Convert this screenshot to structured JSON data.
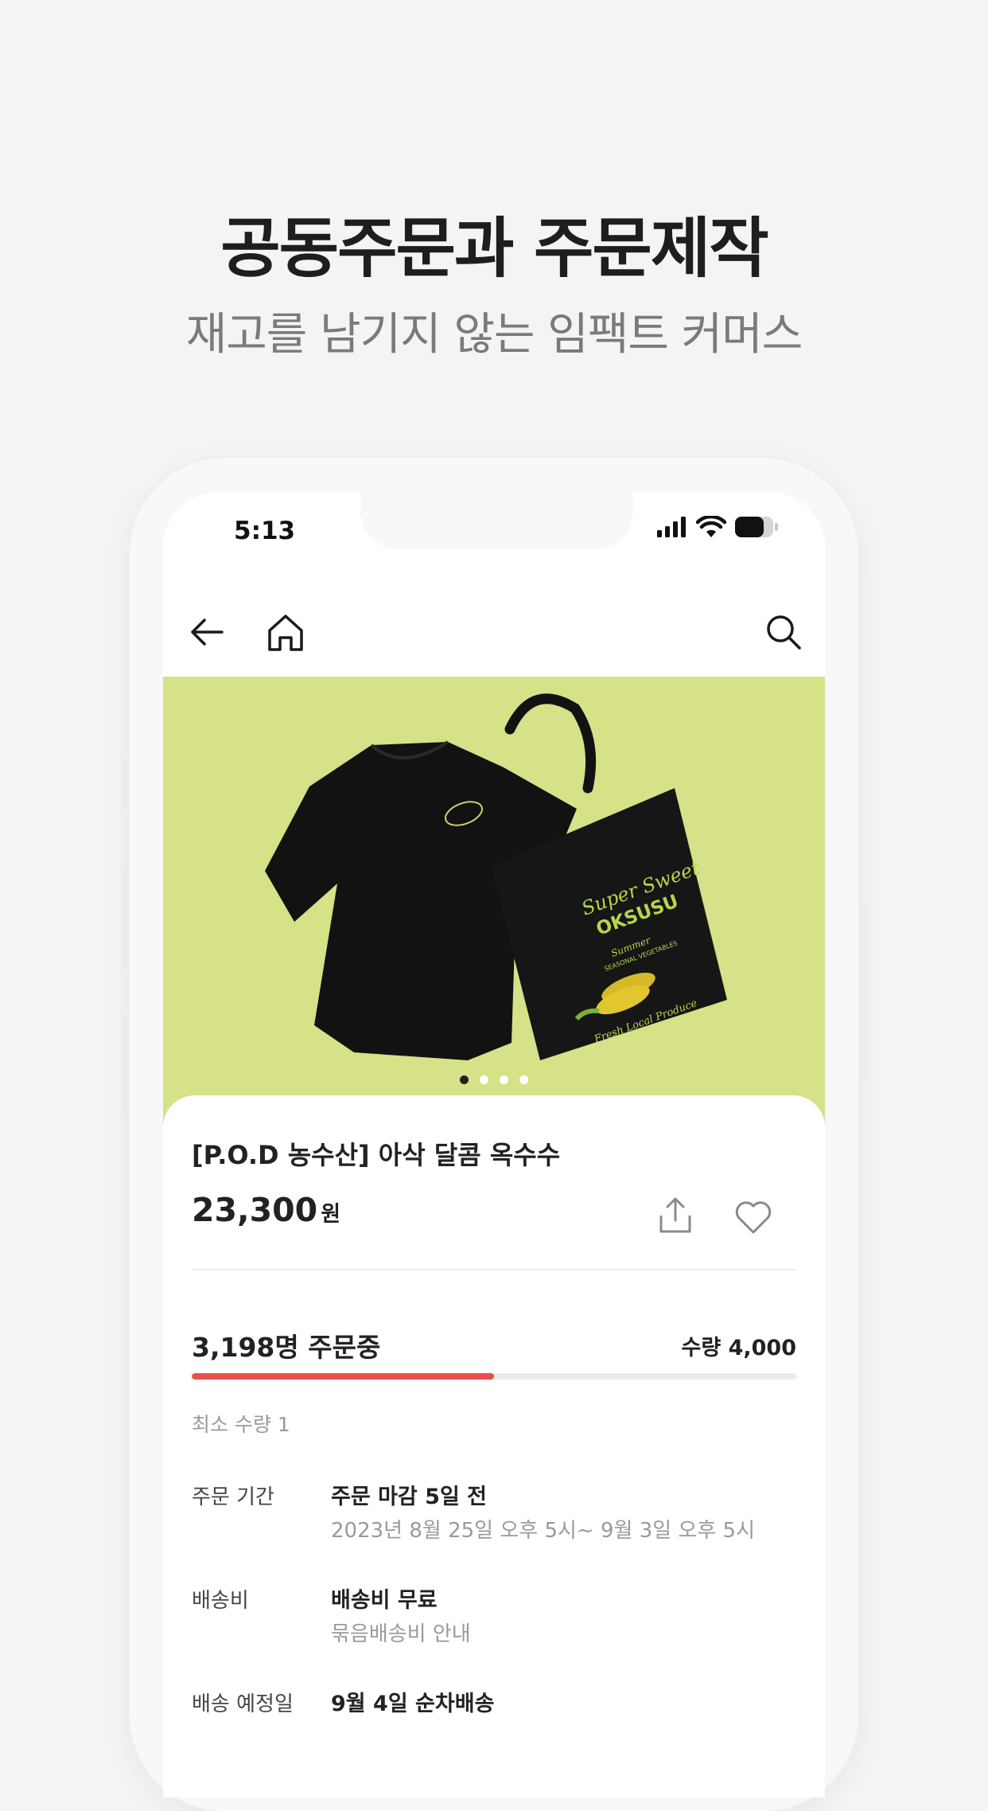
{
  "promo": {
    "headline": "공동주문과 주문제작",
    "subheadline": "재고를 남기지 않는 임팩트 커머스"
  },
  "status_bar": {
    "time": "5:13"
  },
  "nav": {
    "back_icon": "arrow-left-icon",
    "home_icon": "home-icon",
    "search_icon": "search-icon"
  },
  "hero": {
    "carousel_total": 4,
    "carousel_active": 1,
    "background": "#d6e188",
    "print": {
      "line1": "Super Sweet",
      "line2": "OKSUSU",
      "line3": "Summer",
      "line4": "SEASONAL VEGETABLES",
      "line5": "Fresh Local Produce"
    }
  },
  "product": {
    "title": "[P.O.D 농수산] 아삭 달콤 옥수수",
    "price": "23,300",
    "price_unit": "원"
  },
  "order": {
    "ordering_text": "3,198명 주문중",
    "target_text": "수량 4,000",
    "progress": 0.5,
    "min_qty": "최소 수량 1",
    "accent": "#ea4f4b"
  },
  "info": {
    "period_label": "주문 기간",
    "period_value": "주문 마감 5일 전",
    "period_sub": "2023년 8월 25일 오후 5시~ 9월 3일 오후 5시",
    "shipping_label": "배송비",
    "shipping_value": "배송비 무료",
    "shipping_sub": "묶음배송비 안내",
    "delivery_label": "배송 예정일",
    "delivery_value": "9월 4일 순차배송"
  }
}
